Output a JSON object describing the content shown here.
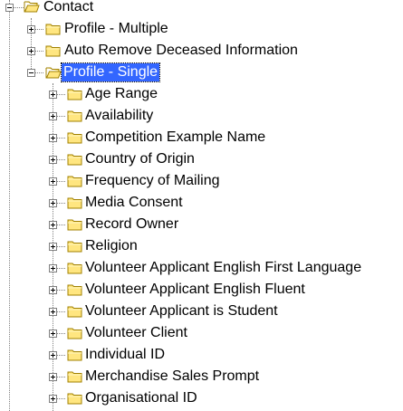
{
  "tree": {
    "root": {
      "label": "Contact",
      "icon": "folder-open-icon",
      "expanded": true
    },
    "level1": [
      {
        "label": "Profile - Multiple",
        "icon": "folder-icon",
        "expanded": false
      },
      {
        "label": "Auto Remove Deceased Information",
        "icon": "folder-icon",
        "expanded": false
      },
      {
        "label": "Profile - Single",
        "icon": "folder-open-icon",
        "expanded": true,
        "selected": true
      }
    ],
    "level2": [
      {
        "label": "Age Range"
      },
      {
        "label": "Availability"
      },
      {
        "label": "Competition Example Name"
      },
      {
        "label": "Country of Origin"
      },
      {
        "label": "Frequency of Mailing"
      },
      {
        "label": "Media Consent"
      },
      {
        "label": "Record Owner"
      },
      {
        "label": "Religion"
      },
      {
        "label": "Volunteer Applicant English First Language"
      },
      {
        "label": "Volunteer Applicant English Fluent"
      },
      {
        "label": "Volunteer Applicant is Student"
      },
      {
        "label": "Volunteer Client"
      },
      {
        "label": "Individual ID"
      },
      {
        "label": "Merchandise Sales Prompt"
      },
      {
        "label": "Organisational ID"
      }
    ]
  },
  "colors": {
    "selection": "#3366ff",
    "folder_fill": "#ffe680",
    "folder_stroke": "#a08000",
    "guide_lines": "#808080"
  }
}
